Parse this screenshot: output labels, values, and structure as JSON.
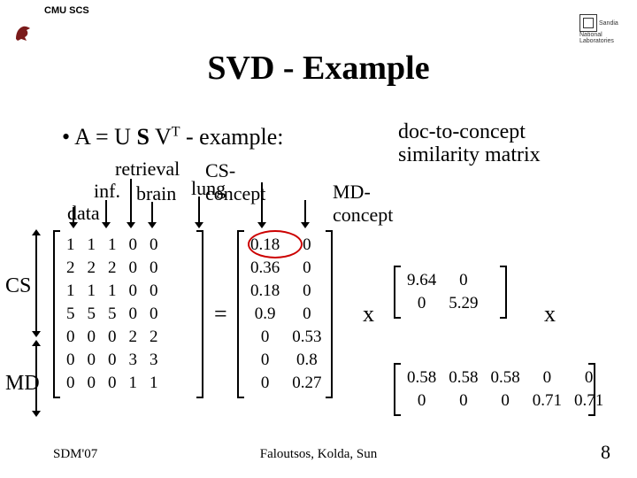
{
  "header": {
    "cmu_scs": "CMU SCS",
    "sandia": "Sandia\nNational\nLaboratories"
  },
  "title": "SVD - Example",
  "bullet": {
    "prefix": "A = U ",
    "sigma": "S",
    "vt": " V",
    "sup": "T",
    "suffix": " - example:"
  },
  "note_line1": "doc-to-concept",
  "note_line2": "similarity matrix",
  "labels": {
    "data": "data",
    "inf": "inf.",
    "retrieval": "retrieval",
    "brain": "brain",
    "lung": "lung",
    "cs_concept": "CS-concept",
    "md_concept": "MD-concept"
  },
  "side": {
    "cs": "CS",
    "md": "MD"
  },
  "ops": {
    "eq": "=",
    "x": "x"
  },
  "matrixA": [
    [
      1,
      1,
      1,
      0,
      0
    ],
    [
      2,
      2,
      2,
      0,
      0
    ],
    [
      1,
      1,
      1,
      0,
      0
    ],
    [
      5,
      5,
      5,
      0,
      0
    ],
    [
      0,
      0,
      0,
      2,
      2
    ],
    [
      0,
      0,
      0,
      3,
      3
    ],
    [
      0,
      0,
      0,
      1,
      1
    ]
  ],
  "matrixU": [
    [
      0.18,
      0
    ],
    [
      0.36,
      0
    ],
    [
      0.18,
      0
    ],
    [
      0.9,
      0
    ],
    [
      0,
      0.53
    ],
    [
      0,
      0.8
    ],
    [
      0,
      0.27
    ]
  ],
  "matrixS": [
    [
      9.64,
      0
    ],
    [
      0,
      5.29
    ]
  ],
  "matrixV": [
    [
      0.58,
      0.58,
      0.58,
      0,
      0
    ],
    [
      0,
      0,
      0,
      0.71,
      0.71
    ]
  ],
  "footer": {
    "left": "SDM'07",
    "center": "Faloutsos, Kolda, Sun",
    "page": "8"
  }
}
